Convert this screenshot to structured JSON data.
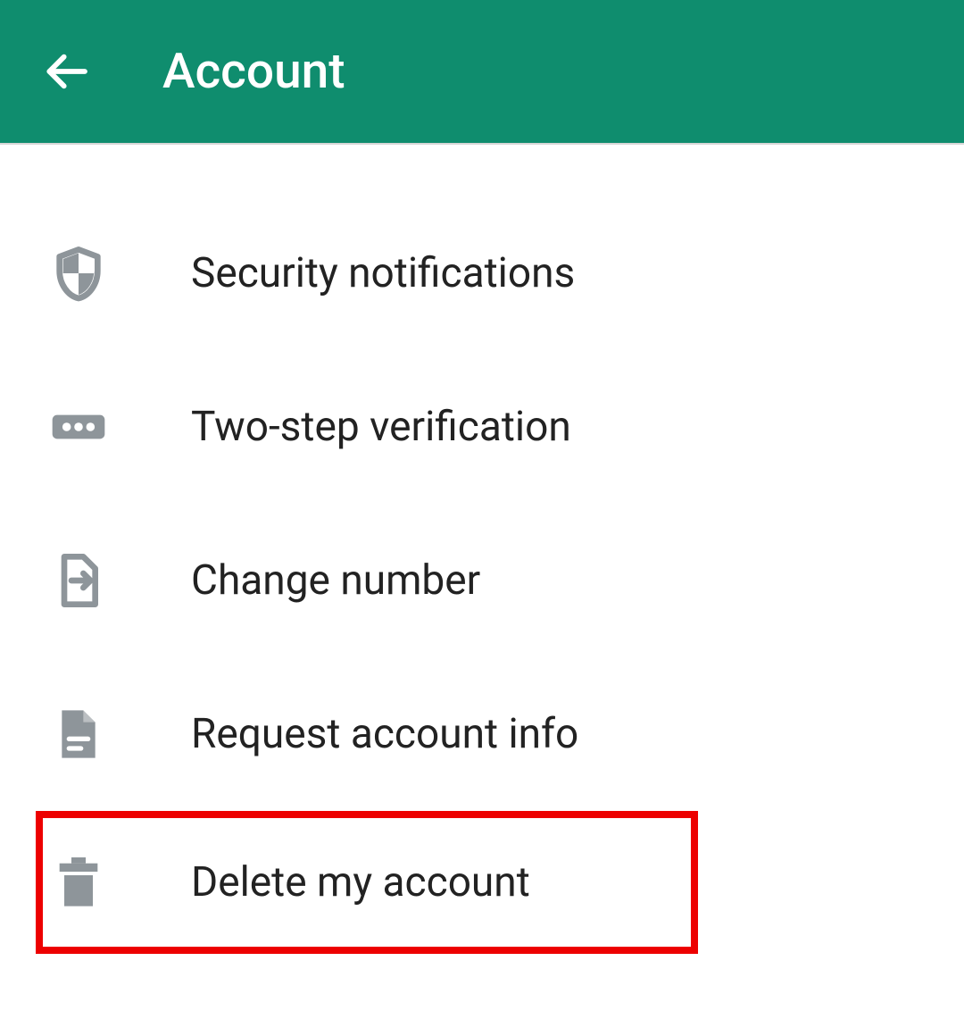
{
  "header": {
    "title": "Account"
  },
  "settings": {
    "items": [
      {
        "label": "Security notifications",
        "icon": "shield-icon"
      },
      {
        "label": "Two-step verification",
        "icon": "dots-icon"
      },
      {
        "label": "Change number",
        "icon": "sim-icon"
      },
      {
        "label": "Request account info",
        "icon": "document-icon"
      },
      {
        "label": "Delete my account",
        "icon": "trash-icon"
      }
    ]
  },
  "colors": {
    "header_bg": "#0f8d6e",
    "icon": "#8e959a",
    "highlight": "#ed0000"
  }
}
